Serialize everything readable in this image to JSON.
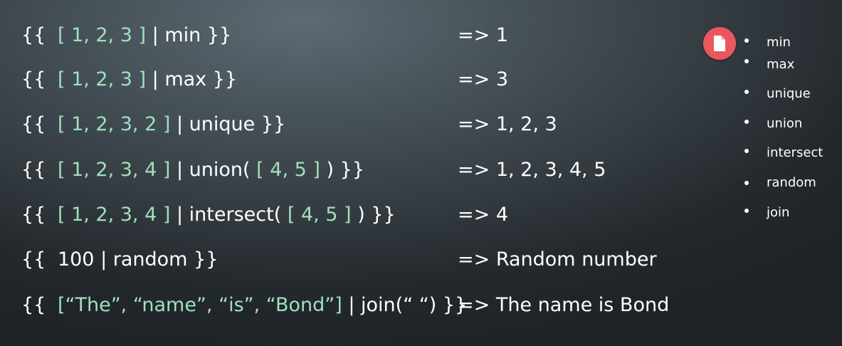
{
  "examples": [
    {
      "open": "{{",
      "parts": [
        {
          "text": "[ 1, 2, 3 ]",
          "accent": true
        },
        {
          "text": "| min }}",
          "accent": false
        }
      ],
      "result": "=> 1"
    },
    {
      "open": "{{",
      "parts": [
        {
          "text": "[ 1, 2, 3 ]",
          "accent": true
        },
        {
          "text": "| max }}",
          "accent": false
        }
      ],
      "result": "=> 3"
    },
    {
      "open": "{{",
      "parts": [
        {
          "text": "[ 1, 2, 3, 2 ]",
          "accent": true
        },
        {
          "text": "| unique }}",
          "accent": false
        }
      ],
      "result": "=> 1, 2, 3"
    },
    {
      "open": "{{",
      "parts": [
        {
          "text": "[ 1, 2, 3, 4 ]",
          "accent": true
        },
        {
          "text": "| union(",
          "accent": false
        },
        {
          "text": "[ 4, 5 ]",
          "accent": true
        },
        {
          "text": ") }}",
          "accent": false
        }
      ],
      "result": "=> 1, 2, 3, 4, 5"
    },
    {
      "open": "{{",
      "parts": [
        {
          "text": "[ 1, 2, 3, 4 ]",
          "accent": true
        },
        {
          "text": "| intersect(",
          "accent": false
        },
        {
          "text": "[ 4, 5 ]",
          "accent": true
        },
        {
          "text": ") }}",
          "accent": false
        }
      ],
      "result": "=> 4"
    },
    {
      "open": "{{",
      "parts": [
        {
          "text": "100 | random }}",
          "accent": false
        }
      ],
      "result": "=> Random number"
    },
    {
      "open": "{{",
      "parts": [
        {
          "text": "[“The”, “name”, “is”, “Bond”]",
          "accent": true
        },
        {
          "text": "| join(“ “) }}",
          "accent": false
        }
      ],
      "result": "=> The name is Bond"
    }
  ],
  "filter_list": [
    "min",
    "max",
    "unique",
    "union",
    "intersect",
    "random",
    "join"
  ],
  "badge_icon": "document-icon",
  "colors": {
    "accent_green": "#9fe0bd",
    "text_white": "#ffffff",
    "badge_red": "#e8585e",
    "background_light": "#5d6b73",
    "background_dark": "#1f2327"
  }
}
